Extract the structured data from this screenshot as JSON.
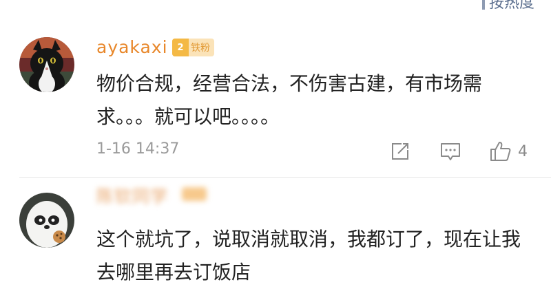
{
  "sort_bar": {
    "label": "按热度"
  },
  "comments": [
    {
      "username": "ayakaxi",
      "level": "2",
      "fan_badge": "铁粉",
      "text": "物价合规，经营合法，不伤害古建，有市场需求。。。就可以吧。。。。",
      "timestamp": "1-16 14:37",
      "likes": "4",
      "avatar_icon": "black-cat-avatar"
    },
    {
      "username": "陈钦同学",
      "text": "这个就坑了，说取消就取消，我都订了，现在让我去哪里再去订饭店",
      "avatar_icon": "panda-cartoon-avatar"
    }
  ],
  "colors": {
    "username": "#e8872a",
    "meta": "#9a9a9a",
    "icon": "#8a8a8a",
    "divider": "#e6e6e6"
  }
}
